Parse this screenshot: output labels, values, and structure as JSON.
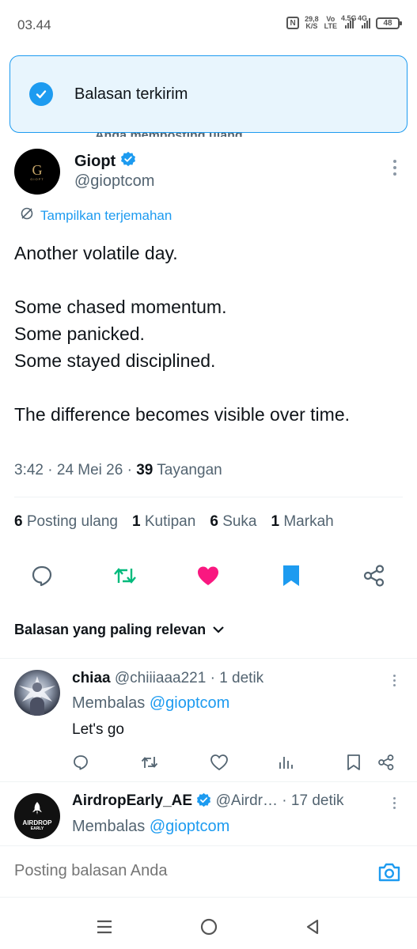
{
  "status_bar": {
    "time": "03.44",
    "nfc": "N",
    "speed_value": "29,8",
    "speed_unit": "K/S",
    "volte_top": "Vo",
    "volte_bottom": "LTE",
    "net1": "4.5G",
    "net2": "4G",
    "battery": "48"
  },
  "toast": {
    "text": "Balasan terkirim",
    "icon": "check-circle-icon"
  },
  "context_peek": "Anda memposting ulang",
  "tweet": {
    "author_name": "Giopt",
    "avatar_letter": "G",
    "avatar_sub": "GIOPT",
    "verified": true,
    "handle": "@gioptcom",
    "translate_label": "Tampilkan terjemahan",
    "body_lines": [
      "Another volatile day.",
      "",
      "Some chased momentum.",
      "Some panicked.",
      "Some stayed disciplined.",
      "",
      "The difference becomes visible over time."
    ],
    "time": "3:42",
    "date": "24 Mei 26",
    "views_count": "39",
    "views_label": "Tayangan",
    "stats": {
      "reposts_count": "6",
      "reposts_label": "Posting ulang",
      "quotes_count": "1",
      "quotes_label": "Kutipan",
      "likes_count": "6",
      "likes_label": "Suka",
      "bookmarks_count": "1",
      "bookmarks_label": "Markah"
    },
    "action_icons": [
      "reply-icon",
      "repost-icon",
      "like-icon",
      "bookmark-icon",
      "share-icon"
    ],
    "accent_color": "#1d9bf0",
    "repost_color": "#00ba7c",
    "like_color": "#f91880"
  },
  "relevance_label": "Balasan yang paling relevan",
  "replies": [
    {
      "name": "chiaa",
      "handle": "@chiiiaaa221",
      "time": "1 detik",
      "replying_prefix": "Membalas",
      "replying_to": "@gioptcom",
      "text": "Let's go"
    },
    {
      "name": "AirdropEarly_AE",
      "handle": "@Airdr…",
      "time": "17 detik",
      "replying_prefix": "Membalas",
      "replying_to": "@gioptcom",
      "avatar_text": "AIRDROP",
      "avatar_text2": "EARLY"
    }
  ],
  "compose": {
    "placeholder": "Posting balasan Anda"
  },
  "nav": [
    "menu-icon",
    "home-icon",
    "back-icon"
  ]
}
